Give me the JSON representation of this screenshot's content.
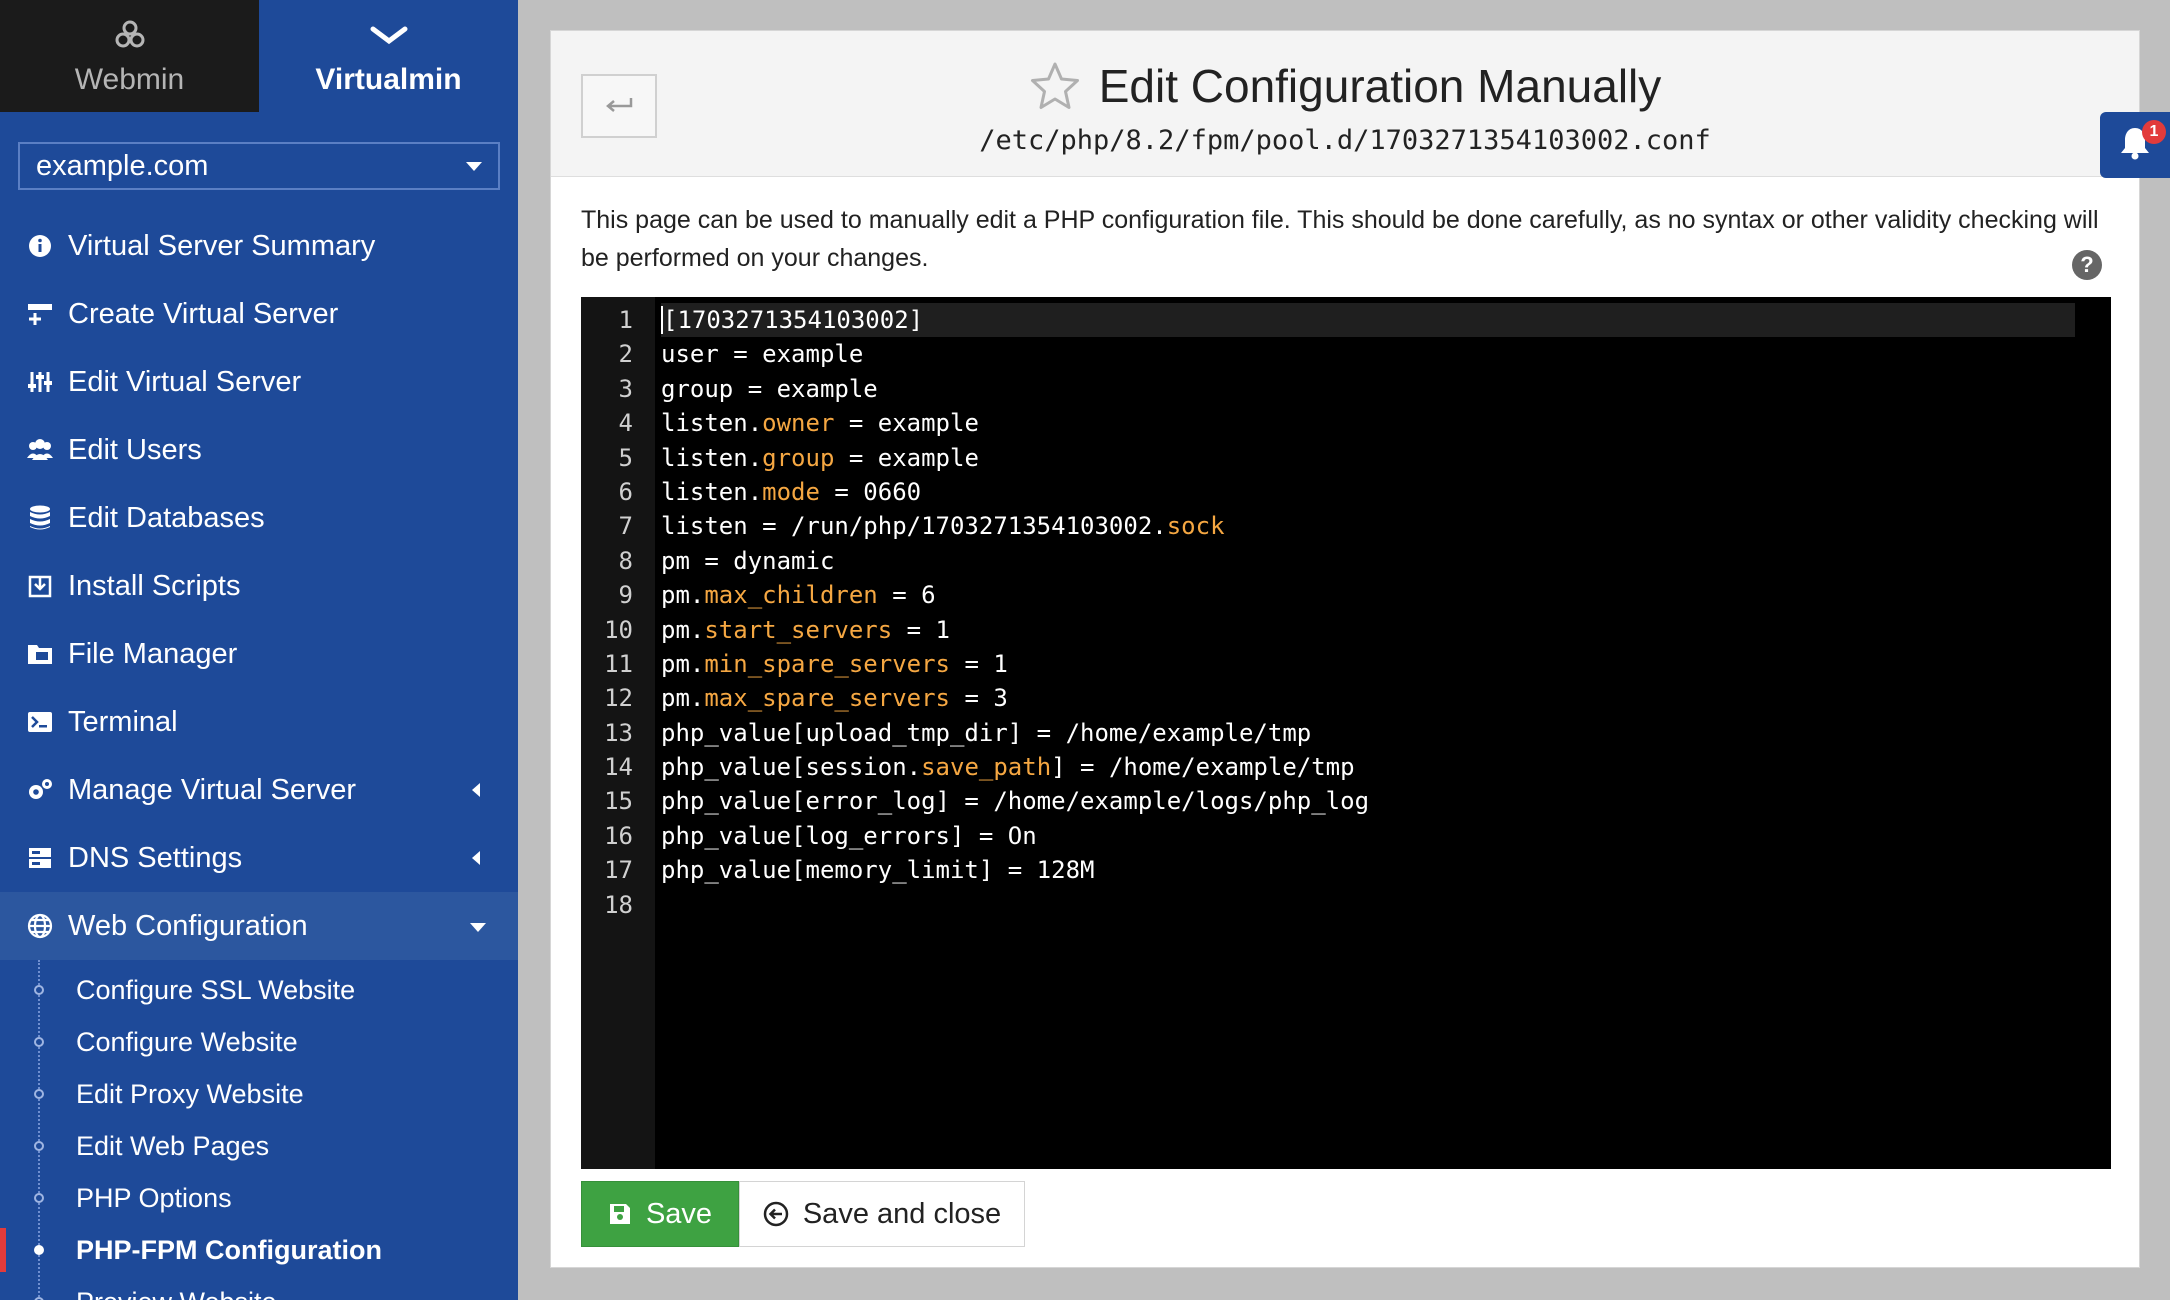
{
  "sidebar": {
    "tabs": [
      {
        "label": "Webmin",
        "icon": "webmin-logo-icon"
      },
      {
        "label": "Virtualmin",
        "icon": "virtualmin-chevron-icon"
      }
    ],
    "domain": "example.com",
    "nav": [
      {
        "label": "Virtual Server Summary",
        "icon": "info-circle-icon"
      },
      {
        "label": "Create Virtual Server",
        "icon": "server-plus-icon"
      },
      {
        "label": "Edit Virtual Server",
        "icon": "sliders-icon"
      },
      {
        "label": "Edit Users",
        "icon": "users-icon"
      },
      {
        "label": "Edit Databases",
        "icon": "database-icon"
      },
      {
        "label": "Install Scripts",
        "icon": "download-icon"
      },
      {
        "label": "File Manager",
        "icon": "folder-icon"
      },
      {
        "label": "Terminal",
        "icon": "terminal-icon"
      },
      {
        "label": "Manage Virtual Server",
        "icon": "cogs-icon",
        "expandable": true
      },
      {
        "label": "DNS Settings",
        "icon": "server-icon",
        "expandable": true
      },
      {
        "label": "Web Configuration",
        "icon": "globe-icon",
        "expandable": true,
        "expanded": true
      }
    ],
    "subnav": [
      {
        "label": "Configure SSL Website"
      },
      {
        "label": "Configure Website"
      },
      {
        "label": "Edit Proxy Website"
      },
      {
        "label": "Edit Web Pages"
      },
      {
        "label": "PHP Options"
      },
      {
        "label": "PHP-FPM Configuration",
        "current": true
      },
      {
        "label": "Preview Website"
      }
    ]
  },
  "header": {
    "title": "Edit Configuration Manually",
    "subtitle": "/etc/php/8.2/fpm/pool.d/1703271354103002.conf",
    "back_icon": "back-arrow-icon",
    "star_icon": "star-outline-icon"
  },
  "intro": "This page can be used to manually edit a PHP configuration file. This should be done carefully, as no syntax or other validity checking will be performed on your changes.",
  "help": "?",
  "editor": {
    "lines": [
      "[1703271354103002]",
      "user = example",
      "group = example",
      "listen.owner = example",
      "listen.group = example",
      "listen.mode = 0660",
      "listen = /run/php/1703271354103002.sock",
      "pm = dynamic",
      "pm.max_children = 6",
      "pm.start_servers = 1",
      "pm.min_spare_servers = 1",
      "pm.max_spare_servers = 3",
      "php_value[upload_tmp_dir] = /home/example/tmp",
      "php_value[session.save_path] = /home/example/tmp",
      "php_value[error_log] = /home/example/logs/php_log",
      "php_value[log_errors] = On",
      "php_value[memory_limit] = 128M",
      ""
    ],
    "cursor_line": 1,
    "highlight_color": "#f5a742"
  },
  "buttons": {
    "save": "Save",
    "save_close": "Save and close"
  },
  "notifications": {
    "count": "1",
    "icon": "bell-icon"
  },
  "colors": {
    "sidebar": "#1e4a99",
    "save_green": "#3ea242",
    "current_marker": "#e23b3b"
  }
}
